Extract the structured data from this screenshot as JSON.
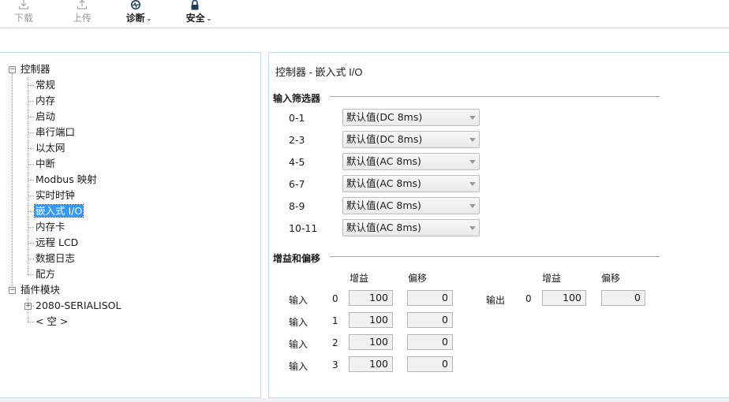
{
  "toolbar": {
    "download": {
      "label": "下载",
      "icon": "download-icon"
    },
    "upload": {
      "label": "上传",
      "icon": "upload-icon"
    },
    "diagnose": {
      "label": "诊断",
      "icon": "diagnostics-icon"
    },
    "security": {
      "label": "安全",
      "icon": "lock-icon"
    }
  },
  "tree": {
    "controller": "控制器",
    "children": [
      "常规",
      "内存",
      "启动",
      "串行端口",
      "以太网",
      "中断",
      "Modbus 映射",
      "实时时钟",
      "嵌入式 I/O",
      "内存卡",
      "远程 LCD",
      "数据日志",
      "配方"
    ],
    "selected_index": 8,
    "plugins": "插件模块",
    "plugin_children": [
      "2080-SERIALISOL",
      "< 空 >"
    ]
  },
  "main": {
    "title": "控制器 - 嵌入式 I/O",
    "input_filter": {
      "heading": "输入筛选器",
      "rows": [
        {
          "label": "0-1",
          "value": "默认值(DC 8ms)"
        },
        {
          "label": "2-3",
          "value": "默认值(DC 8ms)"
        },
        {
          "label": "4-5",
          "value": "默认值(AC 8ms)"
        },
        {
          "label": "6-7",
          "value": "默认值(AC 8ms)"
        },
        {
          "label": "8-9",
          "value": "默认值(AC 8ms)"
        },
        {
          "label": "10-11",
          "value": "默认值(AC 8ms)"
        }
      ]
    },
    "gain_offset": {
      "heading": "增益和偏移",
      "gain_header": "增益",
      "offset_header": "偏移",
      "input_label": "输入",
      "output_label": "输出",
      "inputs": [
        {
          "index": "0",
          "gain": "100",
          "offset": "0"
        },
        {
          "index": "1",
          "gain": "100",
          "offset": "0"
        },
        {
          "index": "2",
          "gain": "100",
          "offset": "0"
        },
        {
          "index": "3",
          "gain": "100",
          "offset": "0"
        }
      ],
      "outputs": [
        {
          "index": "0",
          "gain": "100",
          "offset": "0"
        }
      ]
    }
  }
}
